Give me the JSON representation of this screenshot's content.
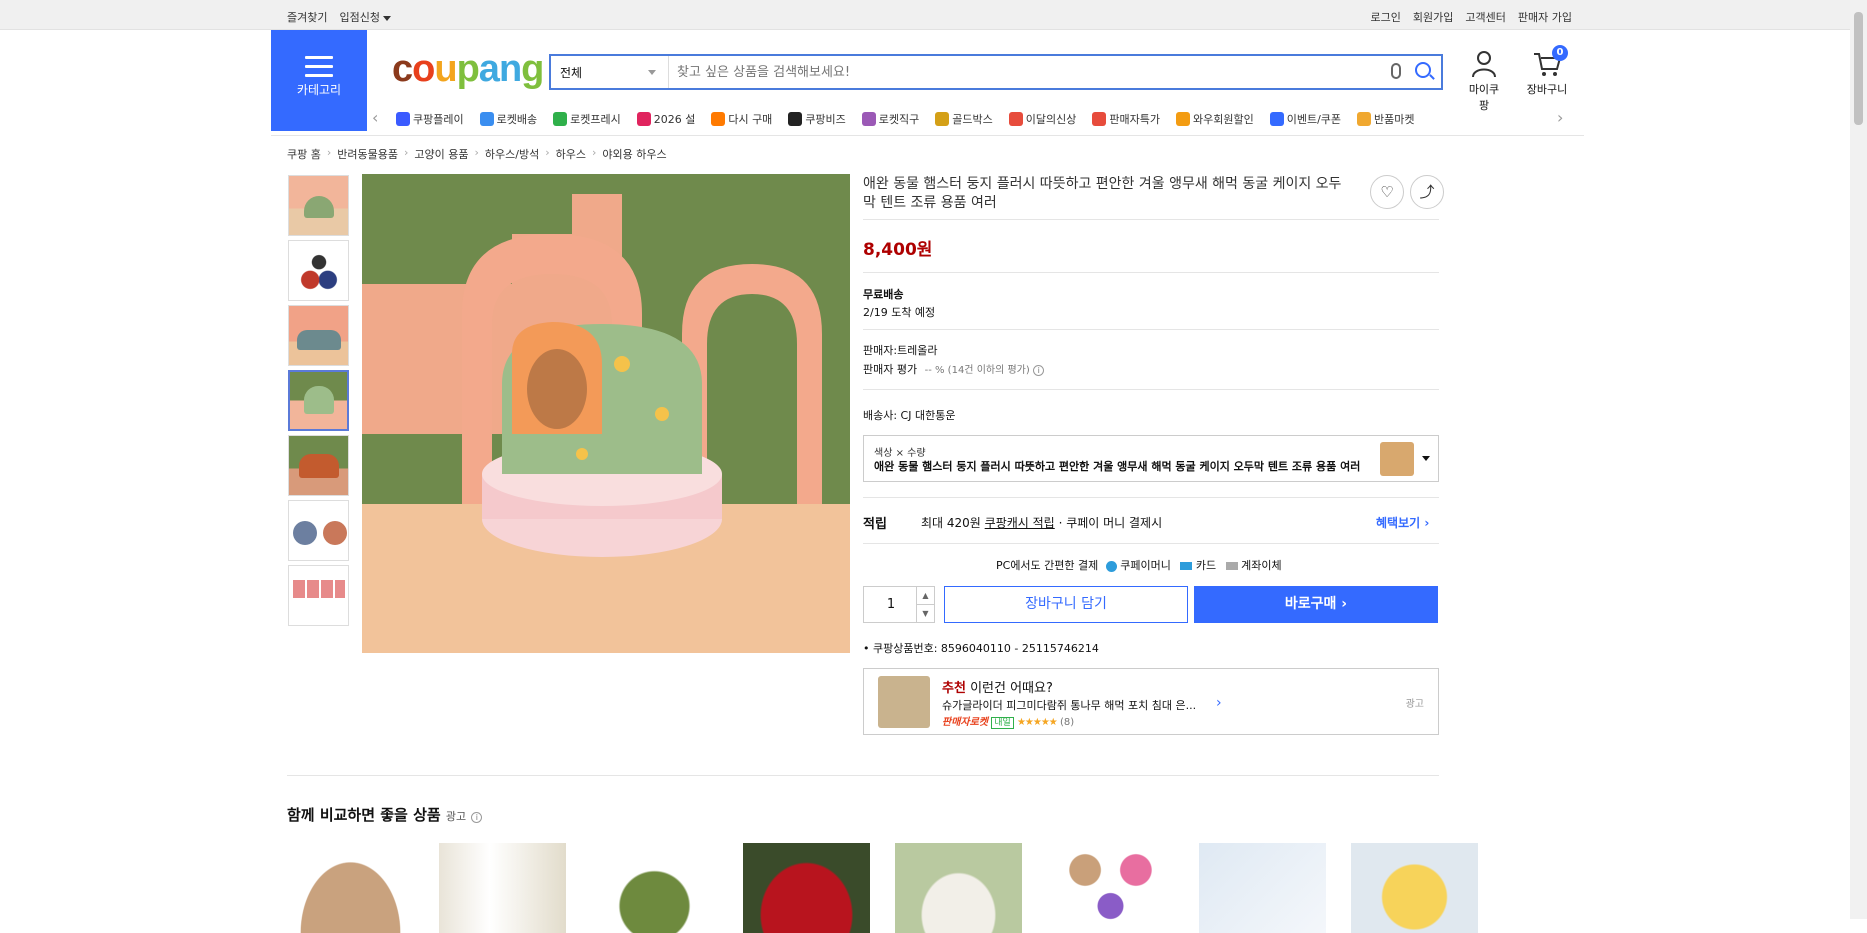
{
  "topbar": {
    "left": [
      "즐겨찾기",
      "입점신청"
    ],
    "right": [
      "로그인",
      "회원가입",
      "고객센터",
      "판매자 가입"
    ]
  },
  "header": {
    "category_label": "카테고리",
    "logo": "coupang",
    "search_category": "전체",
    "search_placeholder": "찾고 싶은 상품을 검색해보세요!",
    "mycoupang_label": "마이쿠팡",
    "cart_label": "장바구니",
    "cart_count": "0"
  },
  "nav": [
    {
      "label": "쿠팡플레이",
      "icon": "play-icon",
      "color": "#3b5bff"
    },
    {
      "label": "로켓배송",
      "icon": "rocket-icon",
      "color": "#3a8ef0"
    },
    {
      "label": "로켓프레시",
      "icon": "rocket-fresh-icon",
      "color": "#2fb04a"
    },
    {
      "label": "2026 설",
      "icon": "gift-icon",
      "color": "#e0245e"
    },
    {
      "label": "다시 구매",
      "icon": "home-icon",
      "color": "#ff7a00"
    },
    {
      "label": "쿠팡비즈",
      "icon": "biz-icon",
      "color": "#222222"
    },
    {
      "label": "로켓직구",
      "icon": "globe-icon",
      "color": "#9b59b6"
    },
    {
      "label": "골드박스",
      "icon": "box-icon",
      "color": "#d4a017"
    },
    {
      "label": "이달의신상",
      "icon": "new-icon",
      "color": "#e74c3c"
    },
    {
      "label": "판매자특가",
      "icon": "percent-icon",
      "color": "#e74c3c"
    },
    {
      "label": "와우회원할인",
      "icon": "wow-icon",
      "color": "#f39c12"
    },
    {
      "label": "이벤트/쿠폰",
      "icon": "coupon-icon",
      "color": "#346aff"
    },
    {
      "label": "반품마켓",
      "icon": "market-icon",
      "color": "#f0a830"
    }
  ],
  "breadcrumb": [
    "쿠팡 홈",
    "반려동물용품",
    "고양이 용품",
    "하우스/방석",
    "하우스",
    "야외용 하우스"
  ],
  "product": {
    "title": "애완 동물 햄스터 둥지 플러시 따뜻하고 편안한 겨울 앵무새 해먹 동굴 케이지 오두막 텐트 조류 용품 여러",
    "price": "8,400원",
    "shipping_title": "무료배송",
    "shipping_eta": "2/19 도착 예정",
    "seller": "판매자:트레올라",
    "seller_rating_label": "판매자 평가",
    "seller_rating_value": "-- % (14건 이하의 평가)",
    "carrier": "배송사: CJ 대한통운",
    "option_label": "색상 × 수량",
    "option_value": "애완 동물 햄스터 둥지 플러시 따뜻하고 편안한 겨울 앵무새 해먹 동굴 케이지 오두막 텐트 조류 용품 여러",
    "reward_label": "적립",
    "reward_text": "최대 420원",
    "reward_link": "쿠팡캐시 적립",
    "reward_suffix": "· 쿠페이 머니 결제시",
    "benefit_link": "혜택보기",
    "payment_title": "PC에서도 간편한 결제",
    "payment_methods": [
      "쿠페이머니",
      "카드",
      "계좌이체"
    ],
    "quantity": "1",
    "add_to_cart": "장바구니 담기",
    "buy_now": "바로구매",
    "product_number": "쿠팡상품번호: 8596040110 - 25115746214"
  },
  "recommend": {
    "tag": "추천",
    "headline": "이런건 어때요?",
    "name": "슈가글라이더 피그미다람쥐 통나무 해먹 포치 침대 은...",
    "seller_badge": "판매자로켓",
    "today": "내일",
    "reviews": "(8)",
    "ad": "광고"
  },
  "compare": {
    "title": "함께 비교하면 좋을 상품",
    "ad": "광고"
  },
  "colors": {
    "accent": "#346aff",
    "price": "#ae0000"
  }
}
